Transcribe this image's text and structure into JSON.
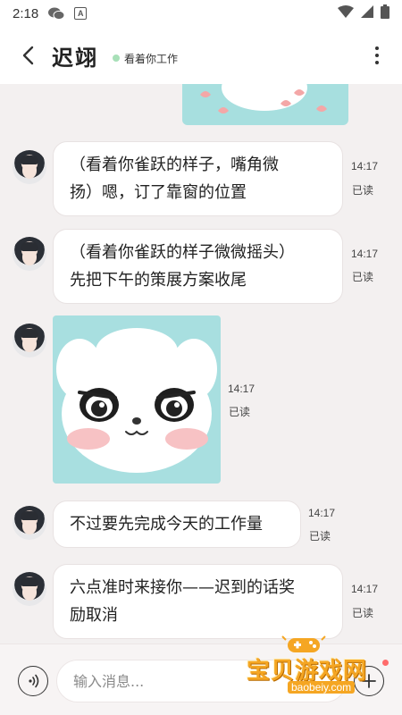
{
  "status_bar": {
    "time": "2:18",
    "icons": [
      "wechat-icon",
      "app-a-icon",
      "wifi-icon",
      "cellular-icon",
      "battery-icon"
    ],
    "app_letter": "A"
  },
  "header": {
    "name": "迟翊",
    "status": "看着你工作",
    "status_dot_color": "#a8e0b8"
  },
  "messages": [
    {
      "type": "text",
      "text_lines": [
        "（看着你雀跃的样子，嘴角微",
        "扬）嗯，订了靠窗的位置"
      ],
      "time": "14:17",
      "read": "已读"
    },
    {
      "type": "text",
      "text_lines": [
        "（看着你雀跃的样子微微摇头）",
        "先把下午的策展方案收尾"
      ],
      "time": "14:17",
      "read": "已读"
    },
    {
      "type": "sticker",
      "sticker": "white-puppy-sticker",
      "time": "14:17",
      "read": "已读"
    },
    {
      "type": "text",
      "text_lines": [
        "不过要先完成今天的工作量"
      ],
      "time": "14:17",
      "read": "已读"
    },
    {
      "type": "text",
      "text_lines": [
        "六点准时来接你——迟到的话奖",
        "励取消"
      ],
      "time": "14:17",
      "read": "已读"
    }
  ],
  "input": {
    "placeholder": "输入消息..."
  },
  "watermark": {
    "title": "宝贝游戏网",
    "url": "baobeiy.com"
  },
  "colors": {
    "background": "#f3f0f0",
    "sticker_bg": "#a8dfe0",
    "bubble_bg": "#ffffff"
  }
}
